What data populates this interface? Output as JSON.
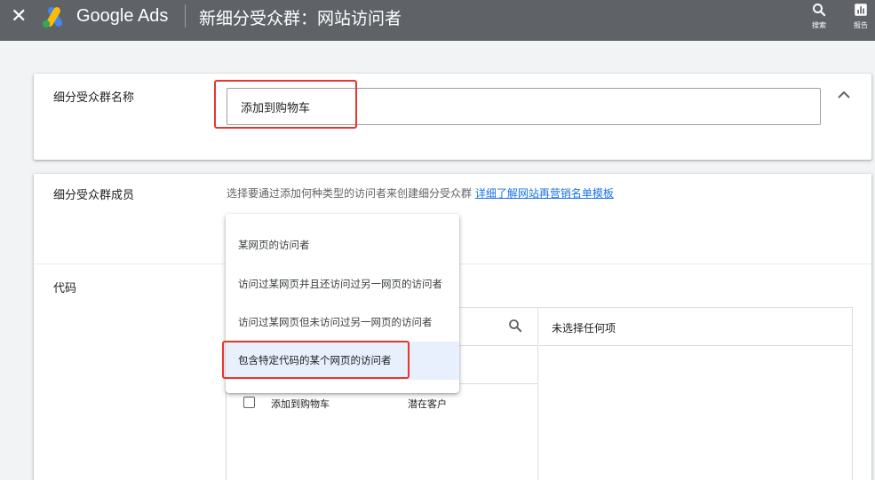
{
  "header": {
    "brand": "Google Ads",
    "title": "新细分受众群：网站访问者",
    "search_label": "搜索",
    "report_label": "报告"
  },
  "name_section": {
    "label": "细分受众群名称",
    "input_value": "添加到购物车"
  },
  "members_section": {
    "label": "细分受众群成员",
    "hint_text": "选择要通过添加何种类型的访问者来创建细分受众群 ",
    "hint_link": "详细了解网站再营销名单模板"
  },
  "code_section": {
    "label": "代码",
    "picker": {
      "right_header": "未选择任何项",
      "rows": [
        {
          "name": "添加到购物车",
          "type": "潜在客户",
          "checked": false
        }
      ]
    }
  },
  "dropdown": {
    "items": [
      {
        "label": "某网页的访问者",
        "selected": false
      },
      {
        "label": "访问过某网页并且还访问过另一网页的访问者",
        "selected": false
      },
      {
        "label": "访问过某网页但未访问过另一网页的访问者",
        "selected": false
      },
      {
        "label": "包含特定代码的某个网页的访问者",
        "selected": true
      }
    ]
  },
  "colors": {
    "topbar": "#5f6368",
    "highlight_border": "#e8362d",
    "link": "#1a73e8",
    "selected_item_bg": "#e8f0fe"
  }
}
